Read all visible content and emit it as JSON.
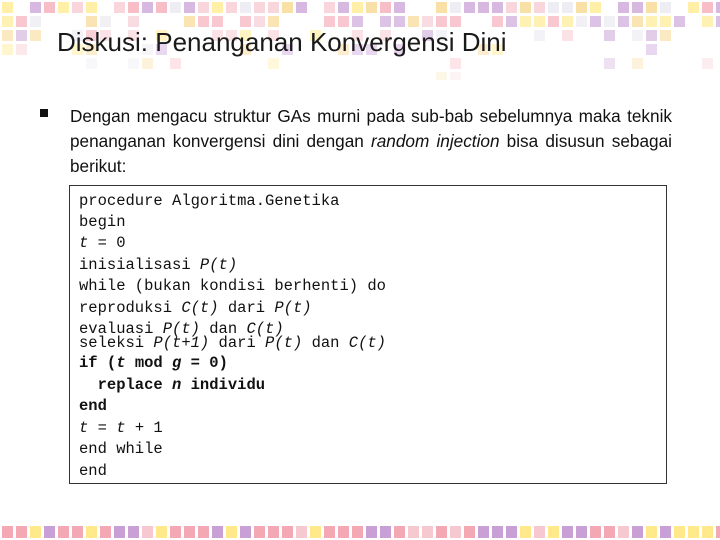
{
  "slide": {
    "title": "Diskusi: Penanganan Konvergensi Dini",
    "bullet": {
      "text_before": "Dengan mengacu struktur GAs murni pada sub-bab sebelumnya maka teknik penanganan konvergensi dini dengan ",
      "emphasis": "random injection",
      "text_after": " bisa disusun sebagai berikut:"
    },
    "code": {
      "l1": "procedure Algoritma.Genetika",
      "l2": "begin",
      "l3": {
        "v": "t",
        "rest": " = 0"
      },
      "l4": {
        "a": "inisialisasi ",
        "b": "P(t)"
      },
      "l5": "while (bukan kondisi berhenti) do",
      "l6": {
        "a": "reproduksi ",
        "b": "C(t)",
        "c": " dari ",
        "d": "P(t)"
      },
      "l7": {
        "a": "evaluasi ",
        "b": "P(t)",
        "c": " dan ",
        "d": "C(t)"
      },
      "l8": {
        "a": "seleksi ",
        "b": "P(t+1)",
        "c": " dari ",
        "d": "P(t)",
        "e": " dan ",
        "f": "C(t)"
      },
      "l9": {
        "a": "if (",
        "b": "t",
        "c": " mod ",
        "d": "g",
        "e": " = 0)"
      },
      "l10": {
        "a": "  replace ",
        "b": "n",
        "c": " individu"
      },
      "l11": "end",
      "l12": {
        "a": "t",
        "b": " = ",
        "c": "t",
        "d": " + 1"
      },
      "l13": "end while",
      "l14": "end"
    }
  },
  "colors": {
    "deco": [
      "#f4a8b4",
      "#f6c8d0",
      "#c9a0d6",
      "#ffe98a",
      "#f7d58a",
      "#e7e7ef"
    ],
    "border": "#333333"
  }
}
